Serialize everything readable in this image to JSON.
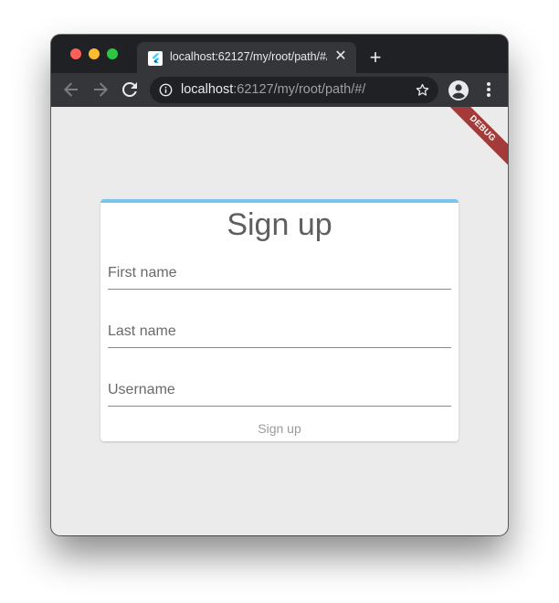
{
  "browser": {
    "tab": {
      "title": "localhost:62127/my/root/path/#/",
      "favicon": "flutter-logo-icon",
      "close_icon": "close-icon"
    },
    "new_tab_icon": "plus-icon",
    "toolbar": {
      "back_icon": "arrow-left-icon",
      "forward_icon": "arrow-right-icon",
      "reload_icon": "reload-icon",
      "address": {
        "host": "localhost",
        "rest": ":62127/my/root/path/#/",
        "info_icon": "info-icon",
        "bookmark_icon": "star-icon"
      },
      "profile_icon": "account-circle-icon",
      "menu_icon": "more-vertical-icon"
    }
  },
  "page": {
    "debug_banner": "DEBUG",
    "form": {
      "progress": 1.0,
      "title": "Sign up",
      "fields": [
        {
          "placeholder": "First name",
          "value": ""
        },
        {
          "placeholder": "Last name",
          "value": ""
        },
        {
          "placeholder": "Username",
          "value": ""
        }
      ],
      "submit_label": "Sign up"
    }
  },
  "colors": {
    "progress": "#7cc2ee",
    "debug_banner": "#a43b3b",
    "page_background": "#ebebeb",
    "browser_chrome": "#35363a"
  }
}
